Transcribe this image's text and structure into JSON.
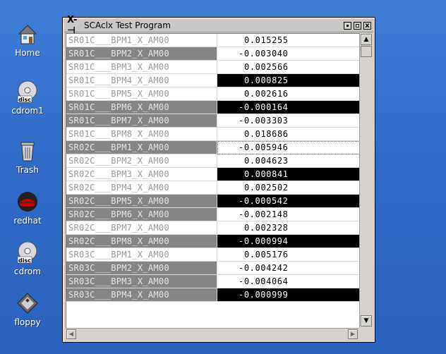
{
  "desktop": {
    "icons": [
      {
        "label": "Home",
        "icon": "home-icon"
      },
      {
        "label": "cdrom1",
        "icon": "disc-icon"
      },
      {
        "label": "Trash",
        "icon": "trash-icon"
      },
      {
        "label": "redhat",
        "icon": "redhat-icon"
      },
      {
        "label": "cdrom",
        "icon": "disc-icon"
      },
      {
        "label": "floppy",
        "icon": "floppy-icon"
      }
    ]
  },
  "window": {
    "title": "SCAclx Test Program",
    "title_icon": "X-⊣",
    "close_glyph": "x"
  },
  "rows": [
    {
      "name": "SR01C___BPM1_X_AM00",
      "value": "0.015255",
      "name_dark": false,
      "value_dark": false
    },
    {
      "name": "SR01C___BPM2_X_AM00",
      "value": "-0.003040",
      "name_dark": true,
      "value_dark": false
    },
    {
      "name": "SR01C___BPM3_X_AM00",
      "value": "0.002566",
      "name_dark": false,
      "value_dark": false
    },
    {
      "name": "SR01C___BPM4_X_AM00",
      "value": "0.000825",
      "name_dark": false,
      "value_dark": true
    },
    {
      "name": "SR01C___BPM5_X_AM00",
      "value": "0.002616",
      "name_dark": false,
      "value_dark": false
    },
    {
      "name": "SR01C___BPM6_X_AM00",
      "value": "-0.000164",
      "name_dark": true,
      "value_dark": true
    },
    {
      "name": "SR01C___BPM7_X_AM00",
      "value": "-0.003303",
      "name_dark": true,
      "value_dark": false
    },
    {
      "name": "SR01C___BPM8_X_AM00",
      "value": "0.018686",
      "name_dark": false,
      "value_dark": false
    },
    {
      "name": "SR02C___BPM1_X_AM00",
      "value": "-0.005946",
      "name_dark": true,
      "value_dark": false,
      "selected": true
    },
    {
      "name": "SR02C___BPM2_X_AM00",
      "value": "0.004623",
      "name_dark": false,
      "value_dark": false
    },
    {
      "name": "SR02C___BPM3_X_AM00",
      "value": "0.000841",
      "name_dark": false,
      "value_dark": true
    },
    {
      "name": "SR02C___BPM4_X_AM00",
      "value": "0.002502",
      "name_dark": false,
      "value_dark": false
    },
    {
      "name": "SR02C___BPM5_X_AM00",
      "value": "-0.000542",
      "name_dark": true,
      "value_dark": true
    },
    {
      "name": "SR02C___BPM6_X_AM00",
      "value": "-0.002148",
      "name_dark": true,
      "value_dark": false
    },
    {
      "name": "SR02C___BPM7_X_AM00",
      "value": "0.002328",
      "name_dark": false,
      "value_dark": false
    },
    {
      "name": "SR02C___BPM8_X_AM00",
      "value": "-0.000994",
      "name_dark": true,
      "value_dark": true
    },
    {
      "name": "SR03C___BPM1_X_AM00",
      "value": "0.005176",
      "name_dark": false,
      "value_dark": false
    },
    {
      "name": "SR03C___BPM2_X_AM00",
      "value": "-0.004242",
      "name_dark": true,
      "value_dark": false
    },
    {
      "name": "SR03C___BPM3_X_AM00",
      "value": "-0.004064",
      "name_dark": true,
      "value_dark": false
    },
    {
      "name": "SR03C___BPM4_X_AM00",
      "value": "-0.000999",
      "name_dark": true,
      "value_dark": true
    }
  ],
  "scrollbars": {
    "up_glyph": "▲",
    "down_glyph": "▼",
    "left_glyph": "◀",
    "right_glyph": "▶"
  }
}
